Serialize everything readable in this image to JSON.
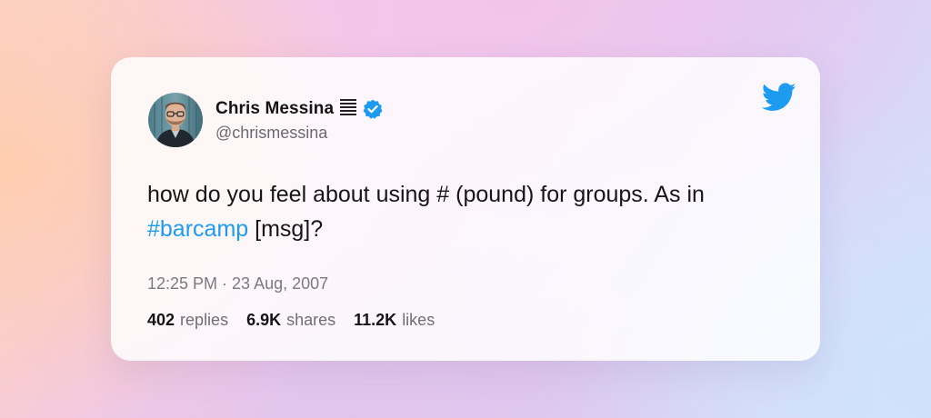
{
  "tweet": {
    "author": {
      "name": "Chris Messina",
      "handle": "@chrismessina",
      "avatar_icon": "avatar-photo",
      "name_glyph_icon": "hash-lines-icon",
      "verified_icon": "verified-badge-icon"
    },
    "brand_icon": "twitter-bird-icon",
    "text_part1": "how do you feel about using # (pound) for groups. As in ",
    "hashtag": "#barcamp",
    "text_part2": " [msg]?",
    "timestamp": "12:25 PM · 23 Aug, 2007",
    "stats": {
      "replies_value": "402",
      "replies_label": "replies",
      "shares_value": "6.9K",
      "shares_label": "shares",
      "likes_value": "11.2K",
      "likes_label": "likes"
    }
  },
  "colors": {
    "accent": "#1d9bf0",
    "text_primary": "#141414",
    "text_secondary": "#6a6a70"
  }
}
